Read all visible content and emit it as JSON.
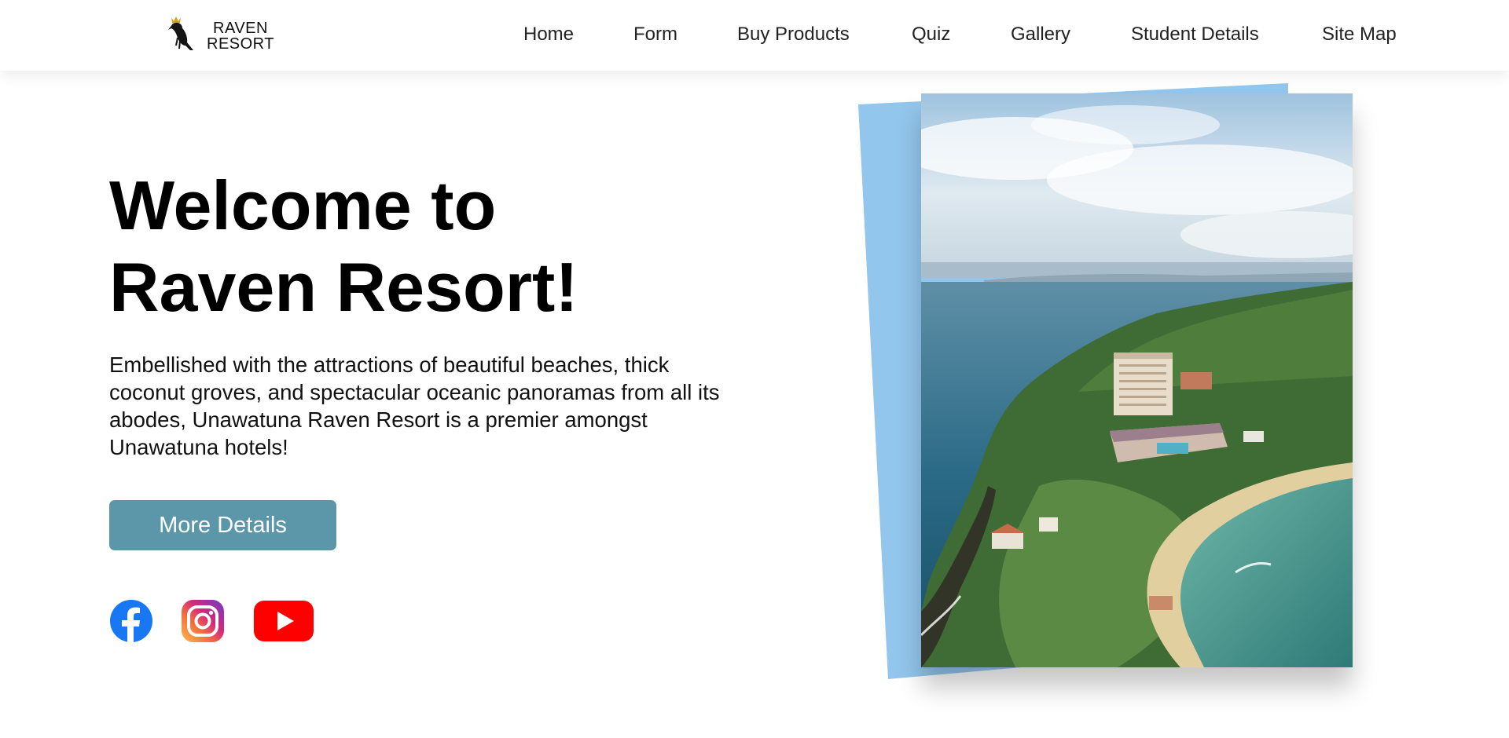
{
  "brand": {
    "line1": "RAVEN",
    "line2": "RESORT"
  },
  "nav": {
    "items": [
      "Home",
      "Form",
      "Buy Products",
      "Quiz",
      "Gallery",
      "Student Details",
      "Site Map"
    ]
  },
  "hero": {
    "title_line1": "Welcome to",
    "title_line2": "Raven Resort!",
    "description": "Embellished with the attractions of beautiful beaches, thick coconut groves, and spectacular oceanic panoramas from all its abodes, Unawatuna Raven Resort is a premier amongst Unawatuna hotels!",
    "cta_label": "More Details"
  },
  "social": [
    "facebook-icon",
    "instagram-icon",
    "youtube-icon"
  ],
  "colors": {
    "accent": "#5b97a9",
    "card_back": "#93c6ec",
    "facebook": "#1877f2",
    "youtube": "#ff0000"
  }
}
